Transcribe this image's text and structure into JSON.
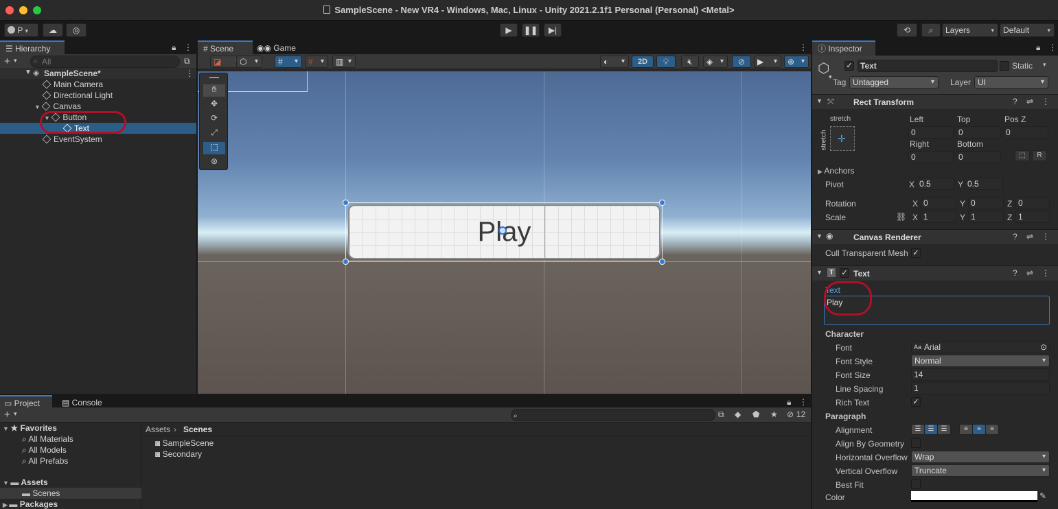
{
  "window": {
    "title": "SampleScene - New VR4 - Windows, Mac, Linux - Unity 2021.2.1f1 Personal (Personal) <Metal>",
    "traffic_colors": [
      "#ff5f57",
      "#febc2e",
      "#28c840"
    ]
  },
  "toolbar": {
    "account_label": "P",
    "layers_label": "Layers",
    "layout_label": "Default"
  },
  "hierarchy": {
    "tab_label": "Hierarchy",
    "search_placeholder": "All",
    "scene_name": "SampleScene*",
    "items": [
      {
        "label": "Main Camera"
      },
      {
        "label": "Directional Light"
      },
      {
        "label": "Canvas"
      },
      {
        "label": "Button"
      },
      {
        "label": "Text"
      },
      {
        "label": "EventSystem"
      }
    ]
  },
  "scene_view": {
    "tabs": [
      "Scene",
      "Game"
    ],
    "mode_2d_label": "2D",
    "button_text": "Play"
  },
  "project": {
    "tabs": [
      "Project",
      "Console"
    ],
    "hidden_count": "12",
    "favorites_label": "Favorites",
    "favorites": [
      "All Materials",
      "All Models",
      "All Prefabs"
    ],
    "assets_label": "Assets",
    "assets_children": [
      "Scenes"
    ],
    "packages_label": "Packages",
    "breadcrumb": [
      "Assets",
      "Scenes"
    ],
    "files": [
      "SampleScene",
      "Secondary"
    ]
  },
  "inspector": {
    "tab_label": "Inspector",
    "object_name": "Text",
    "static_label": "Static",
    "tag_label": "Tag",
    "tag_value": "Untagged",
    "layer_label": "Layer",
    "layer_value": "UI",
    "rect_transform": {
      "title": "Rect Transform",
      "anchor_preset": "stretch",
      "left_label": "Left",
      "left": "0",
      "top_label": "Top",
      "top": "0",
      "posz_label": "Pos Z",
      "posz": "0",
      "right_label": "Right",
      "right": "0",
      "bottom_label": "Bottom",
      "bottom": "0",
      "r_label": "R",
      "anchors_label": "Anchors",
      "pivot_label": "Pivot",
      "pivot_x": "0.5",
      "pivot_y": "0.5",
      "rotation_label": "Rotation",
      "rot_x": "0",
      "rot_y": "0",
      "rot_z": "0",
      "scale_label": "Scale",
      "scale_x": "1",
      "scale_y": "1",
      "scale_z": "1",
      "x": "X",
      "y": "Y",
      "z": "Z"
    },
    "canvas_renderer": {
      "title": "Canvas Renderer",
      "cull_label": "Cull Transparent Mesh"
    },
    "text_component": {
      "title": "Text",
      "text_label": "Text",
      "text_value": "Play",
      "character_label": "Character",
      "font_label": "Font",
      "font_value": "Arial",
      "font_style_label": "Font Style",
      "font_style_value": "Normal",
      "font_size_label": "Font Size",
      "font_size_value": "14",
      "line_spacing_label": "Line Spacing",
      "line_spacing_value": "1",
      "rich_text_label": "Rich Text",
      "paragraph_label": "Paragraph",
      "alignment_label": "Alignment",
      "align_geometry_label": "Align By Geometry",
      "h_overflow_label": "Horizontal Overflow",
      "h_overflow_value": "Wrap",
      "v_overflow_label": "Vertical Overflow",
      "v_overflow_value": "Truncate",
      "best_fit_label": "Best Fit",
      "color_label": "Color"
    }
  },
  "colors": {
    "accent": "#3a79bb",
    "selection": "#2c5d87",
    "annotation": "#b0102a"
  }
}
